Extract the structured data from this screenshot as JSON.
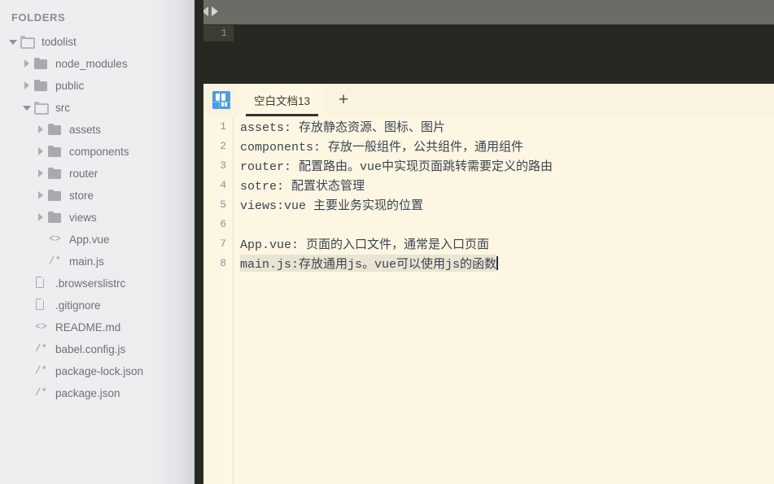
{
  "sidebar": {
    "title": "FOLDERS",
    "items": [
      {
        "label": "todolist",
        "indent": 0,
        "arrow": "down",
        "icon": "folder-open-icon"
      },
      {
        "label": "node_modules",
        "indent": 1,
        "arrow": "right",
        "icon": "folder-closed-icon"
      },
      {
        "label": "public",
        "indent": 1,
        "arrow": "right",
        "icon": "folder-closed-icon"
      },
      {
        "label": "src",
        "indent": 1,
        "arrow": "down",
        "icon": "folder-open-icon"
      },
      {
        "label": "assets",
        "indent": 2,
        "arrow": "right",
        "icon": "folder-closed-icon"
      },
      {
        "label": "components",
        "indent": 2,
        "arrow": "right",
        "icon": "folder-closed-icon"
      },
      {
        "label": "router",
        "indent": 2,
        "arrow": "right",
        "icon": "folder-closed-icon"
      },
      {
        "label": "store",
        "indent": 2,
        "arrow": "right",
        "icon": "folder-closed-icon"
      },
      {
        "label": "views",
        "indent": 2,
        "arrow": "right",
        "icon": "folder-closed-icon"
      },
      {
        "label": "App.vue",
        "indent": 2,
        "arrow": "none",
        "icon": "code-file-icon",
        "glyph": "<>"
      },
      {
        "label": "main.js",
        "indent": 2,
        "arrow": "none",
        "icon": "js-file-icon",
        "glyph": "/*"
      },
      {
        "label": ".browserslistrc",
        "indent": 1,
        "arrow": "none",
        "icon": "plain-file-icon"
      },
      {
        "label": ".gitignore",
        "indent": 1,
        "arrow": "none",
        "icon": "plain-file-icon"
      },
      {
        "label": "README.md",
        "indent": 1,
        "arrow": "none",
        "icon": "code-file-icon",
        "glyph": "<>"
      },
      {
        "label": "babel.config.js",
        "indent": 1,
        "arrow": "none",
        "icon": "js-file-icon",
        "glyph": "/*"
      },
      {
        "label": "package-lock.json",
        "indent": 1,
        "arrow": "none",
        "icon": "js-file-icon",
        "glyph": "/*"
      },
      {
        "label": "package.json",
        "indent": 1,
        "arrow": "none",
        "icon": "js-file-icon",
        "glyph": "/*"
      }
    ]
  },
  "dark_editor": {
    "nav_back_icon": "arrow-left-icon",
    "nav_forward_icon": "arrow-right-icon",
    "line_number": "1"
  },
  "document": {
    "app_icon": "wps-writer-icon",
    "tab_label": "空白文档13",
    "new_tab_label": "+",
    "lines": [
      {
        "no": "1",
        "text": "assets: 存放静态资源、图标、图片",
        "active": false
      },
      {
        "no": "2",
        "text": "components: 存放一般组件，公共组件，通用组件",
        "active": false
      },
      {
        "no": "3",
        "text": "router: 配置路由。vue中实现页面跳转需要定义的路由",
        "active": false
      },
      {
        "no": "4",
        "text": "sotre: 配置状态管理",
        "active": false
      },
      {
        "no": "5",
        "text": "views:vue 主要业务实现的位置",
        "active": false
      },
      {
        "no": "6",
        "text": "",
        "active": false
      },
      {
        "no": "7",
        "text": "App.vue: 页面的入口文件，通常是入口页面",
        "active": false
      },
      {
        "no": "8",
        "text": "main.js:存放通用js。vue可以使用js的函数",
        "active": true
      }
    ]
  },
  "colors": {
    "sidebar_bg": "#edeef0",
    "dark_editor_bg": "#272822",
    "dark_toolbar_bg": "#6b6c66",
    "doc_bg": "#fdf6e3",
    "doc_text": "#3c4450",
    "active_line_bg": "#eae4d3",
    "tab_underline": "#3a3527",
    "wps_blue": "#4a9fdc"
  }
}
